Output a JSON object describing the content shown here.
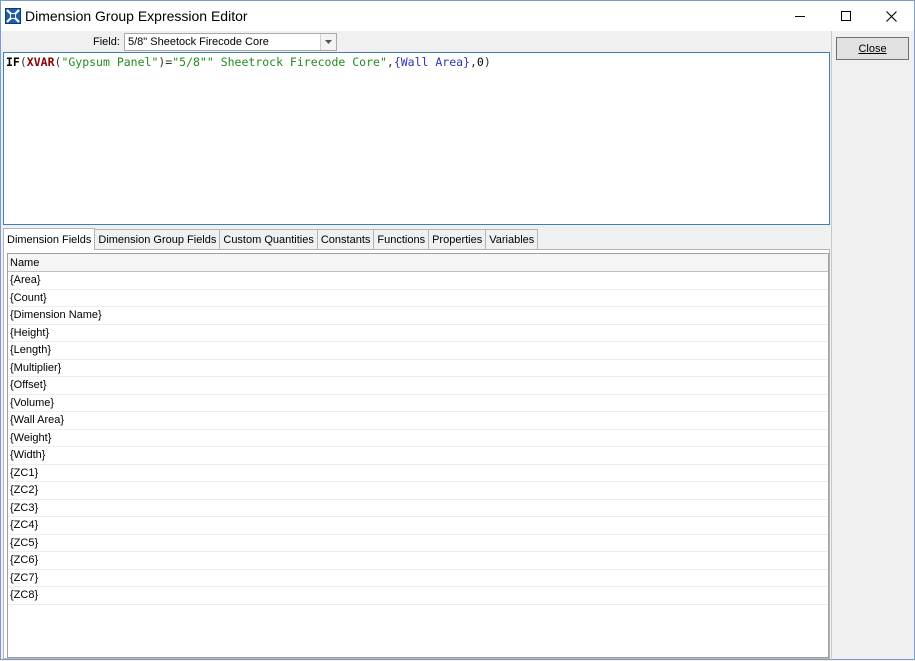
{
  "window": {
    "title": "Dimension Group Expression Editor"
  },
  "field": {
    "label": "Field:",
    "value": "5/8\" Sheetock Firecode Core"
  },
  "expression": {
    "tokens": [
      {
        "text": "IF",
        "kind": "kw"
      },
      {
        "text": "(",
        "kind": "p"
      },
      {
        "text": "XVAR",
        "kind": "fn"
      },
      {
        "text": "(",
        "kind": "p"
      },
      {
        "text": "\"Gypsum Panel\"",
        "kind": "str"
      },
      {
        "text": ")=",
        "kind": "p"
      },
      {
        "text": "\"5/8\"\" Sheetrock Firecode Core\"",
        "kind": "str"
      },
      {
        "text": ",",
        "kind": "p"
      },
      {
        "text": "{Wall Area}",
        "kind": "fld"
      },
      {
        "text": ",",
        "kind": "p"
      },
      {
        "text": "0",
        "kind": "num"
      },
      {
        "text": ")",
        "kind": "p"
      }
    ]
  },
  "buttons": {
    "close": "Close"
  },
  "tabs": [
    {
      "label": "Dimension Fields",
      "active": true
    },
    {
      "label": "Dimension Group Fields",
      "active": false
    },
    {
      "label": "Custom Quantities",
      "active": false
    },
    {
      "label": "Constants",
      "active": false
    },
    {
      "label": "Functions",
      "active": false
    },
    {
      "label": "Properties",
      "active": false
    },
    {
      "label": "Variables",
      "active": false
    }
  ],
  "grid": {
    "column": "Name",
    "rows": [
      "{Area}",
      "{Count}",
      "{Dimension Name}",
      "{Height}",
      "{Length}",
      "{Multiplier}",
      "{Offset}",
      "{Volume}",
      "{Wall Area}",
      "{Weight}",
      "{Width}",
      "{ZC1}",
      "{ZC2}",
      "{ZC3}",
      "{ZC4}",
      "{ZC5}",
      "{ZC6}",
      "{ZC7}",
      "{ZC8}"
    ]
  },
  "icons": {
    "app": "app-icon",
    "minimize": "minimize-icon",
    "maximize": "maximize-icon",
    "close": "close-icon",
    "dropdown": "chevron-down-icon"
  }
}
